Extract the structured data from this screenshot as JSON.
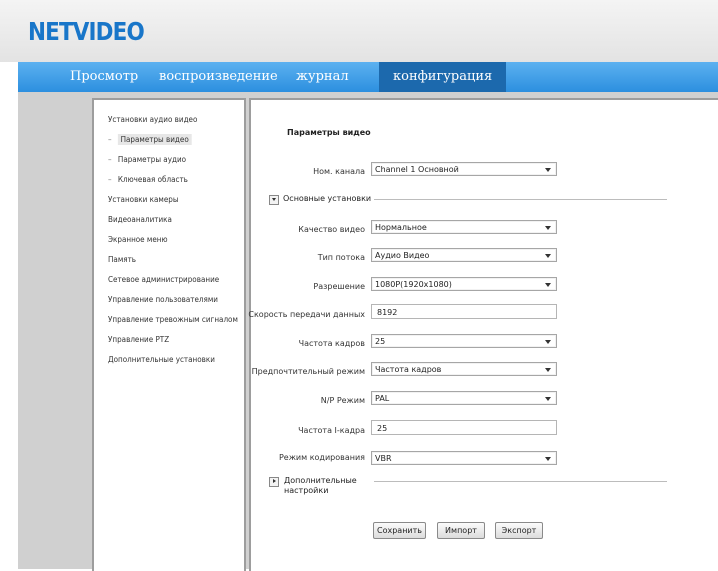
{
  "header": {
    "logo": "NETVIDEO"
  },
  "nav": {
    "items": [
      "Просмотр",
      "воспроизведение",
      "журнал",
      "конфигурация"
    ],
    "active": "конфигурация"
  },
  "sidebar": {
    "items": [
      {
        "label": "Установки аудио видео",
        "sub": false
      },
      {
        "label": "Параметры видео",
        "sub": true,
        "selected": true
      },
      {
        "label": "Параметры аудио",
        "sub": true
      },
      {
        "label": "Ключевая область",
        "sub": true
      },
      {
        "label": "Установки камеры",
        "sub": false
      },
      {
        "label": "Видеоаналитика",
        "sub": false
      },
      {
        "label": "Экранное меню",
        "sub": false
      },
      {
        "label": "Память",
        "sub": false
      },
      {
        "label": "Сетевое администрирование",
        "sub": false
      },
      {
        "label": "Управление пользователями",
        "sub": false
      },
      {
        "label": "Управление тревожным сигналом",
        "sub": false
      },
      {
        "label": "Управление PTZ",
        "sub": false
      },
      {
        "label": "Дополнительные установки",
        "sub": false
      }
    ]
  },
  "form": {
    "title": "Параметры видео",
    "channel": {
      "label": "Ном. канала",
      "value": "Channel 1 Основной"
    },
    "basic_section": "Основные установки",
    "quality": {
      "label": "Качество видео",
      "value": "Нормальное"
    },
    "stream_type": {
      "label": "Тип потока",
      "value": "Аудио Видео"
    },
    "resolution": {
      "label": "Разрешение",
      "value": "1080P(1920x1080)"
    },
    "bitrate": {
      "label": "Скорость передачи данных",
      "value": "8192"
    },
    "fps": {
      "label": "Частота кадров",
      "value": "25"
    },
    "preferred_mode": {
      "label": "Предпочтительный режим",
      "value": "Частота кадров"
    },
    "np_mode": {
      "label": "N/P Режим",
      "value": "PAL"
    },
    "iframe": {
      "label": "Частота I-кадра",
      "value": "25"
    },
    "encoding": {
      "label": "Режим кодирования",
      "value": "VBR"
    },
    "advanced_section_line1": "Дополнительные",
    "advanced_section_line2": "настройки",
    "buttons": {
      "save": "Сохранить",
      "import": "Импорт",
      "export": "Экспорт"
    }
  },
  "colors": {
    "nav_bg": "#3d9de6",
    "nav_active": "#1c69ad",
    "logo": "#1976c9"
  }
}
